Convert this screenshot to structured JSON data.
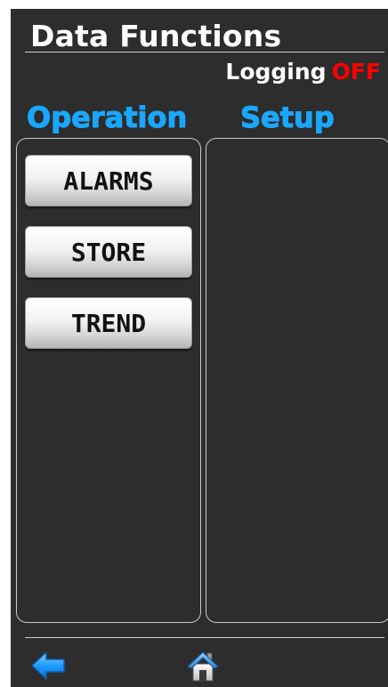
{
  "header": {
    "title": "Data Functions",
    "logging_label": "Logging",
    "logging_status": "OFF",
    "logging_status_color": "#ff0000"
  },
  "sections": {
    "operation_label": "Operation",
    "setup_label": "Setup",
    "label_color": "#1aa7ff"
  },
  "operation_buttons": [
    {
      "label": "ALARMS"
    },
    {
      "label": "STORE"
    },
    {
      "label": "TREND"
    }
  ],
  "footer": {
    "back_icon": "back-arrow-icon",
    "home_icon": "home-icon"
  },
  "colors": {
    "background": "#2d2d2d",
    "back_arrow": "#1e9bff"
  }
}
